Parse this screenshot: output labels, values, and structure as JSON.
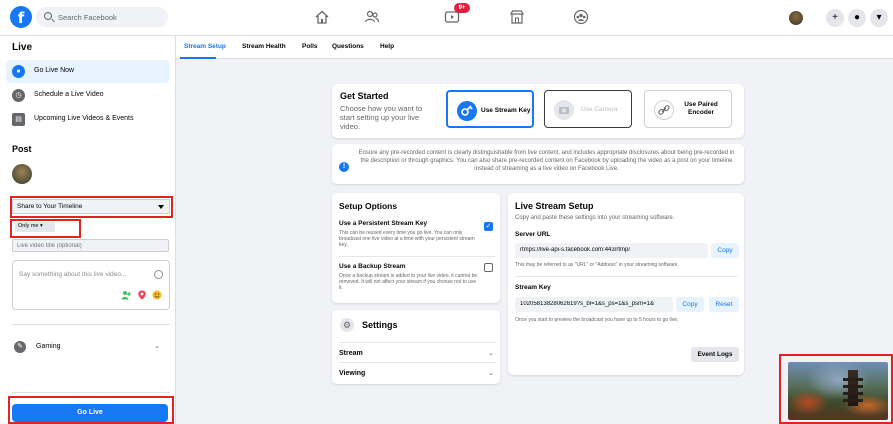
{
  "header": {
    "logo": "f",
    "search_placeholder": "Search Facebook",
    "notification_badge": "9+",
    "icons": [
      "home-icon",
      "friends-icon",
      "watch-icon",
      "marketplace-icon",
      "groups-icon"
    ],
    "right_buttons": [
      "+",
      "●",
      "▾"
    ]
  },
  "sidebar": {
    "title": "Live",
    "items": [
      {
        "label": "Go Live Now",
        "icon": "live-icon"
      },
      {
        "label": "Schedule a Live Video",
        "icon": "clock-icon"
      },
      {
        "label": "Upcoming Live Videos & Events",
        "icon": "calendar-icon"
      }
    ],
    "post_heading": "Post",
    "share_select": "Share to Your Timeline",
    "audience": "Only me ▾",
    "title_placeholder": "Live video title (optional)",
    "desc_placeholder": "Say something about this live video...",
    "gaming_label": "Gaming",
    "go_live_button": "Go Live"
  },
  "tabs": [
    "Stream Setup",
    "Stream Health",
    "Polls",
    "Questions",
    "Help"
  ],
  "get_started": {
    "title": "Get Started",
    "subtitle": "Choose how you want to start setting up your live video.",
    "options": [
      {
        "label": "Use Stream Key",
        "selected": true
      },
      {
        "label": "Use Camera",
        "selected": false
      },
      {
        "label": "Use Paired Encoder",
        "selected": false
      }
    ]
  },
  "notice": "Ensure any pre-recorded content is clearly distinguishable from live content, and includes appropriate disclosures about being pre-recorded in the description or through graphics. You can also share pre-recorded content on Facebook by uploading the video as a post on your timeline instead of streaming as a live video on Facebook Live.",
  "setup_options": {
    "title": "Setup Options",
    "items": [
      {
        "title": "Use a Persistent Stream Key",
        "desc": "This can be reused every time you go live. You can only broadcast one live video at a time with your persistent stream key.",
        "checked": true
      },
      {
        "title": "Use a Backup Stream",
        "desc": "Once a backup stream is added to your live video, it cannot be removed. It will not affect your stream if you choose not to use it.",
        "checked": false
      }
    ]
  },
  "settings": {
    "title": "Settings",
    "rows": [
      "Stream",
      "Viewing"
    ]
  },
  "live_stream_setup": {
    "title": "Live Stream Setup",
    "subtitle": "Copy and paste these settings into your streaming software.",
    "server_url_label": "Server URL",
    "server_url": "rtmps://live-api-s.facebook.com:443/rtmp/",
    "server_note": "This may be referred to as \"URL\" or \"Address\" in your streaming software.",
    "stream_key_label": "Stream Key",
    "stream_key": "10205813828062619?s_bl=1&s_ps=1&s_psm=1&",
    "stream_key_note": "Once you start to preview the broadcast you have up to 5 hours to go live.",
    "copy_label": "Copy",
    "reset_label": "Reset",
    "event_logs": "Event Logs"
  },
  "colors": {
    "brand": "#1877f2",
    "highlight": "#e02424"
  }
}
